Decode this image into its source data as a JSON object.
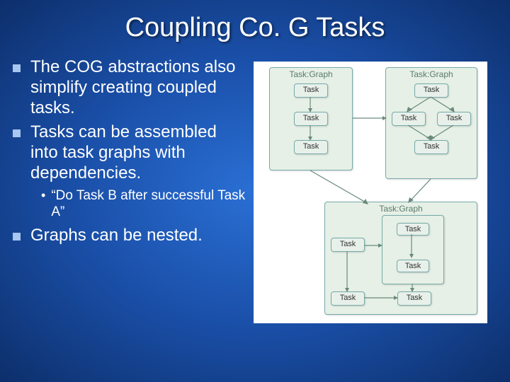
{
  "title": "Coupling Co. G Tasks",
  "bullets": [
    "The COG abstractions also simplify creating coupled tasks.",
    "Tasks can be assembled into task graphs with dependencies."
  ],
  "sub_bullet": "“Do Task B after successful Task A”",
  "bullet3": "Graphs can be nested.",
  "diagram": {
    "label_taskgraph": "Task:Graph",
    "label_task": "Task"
  }
}
